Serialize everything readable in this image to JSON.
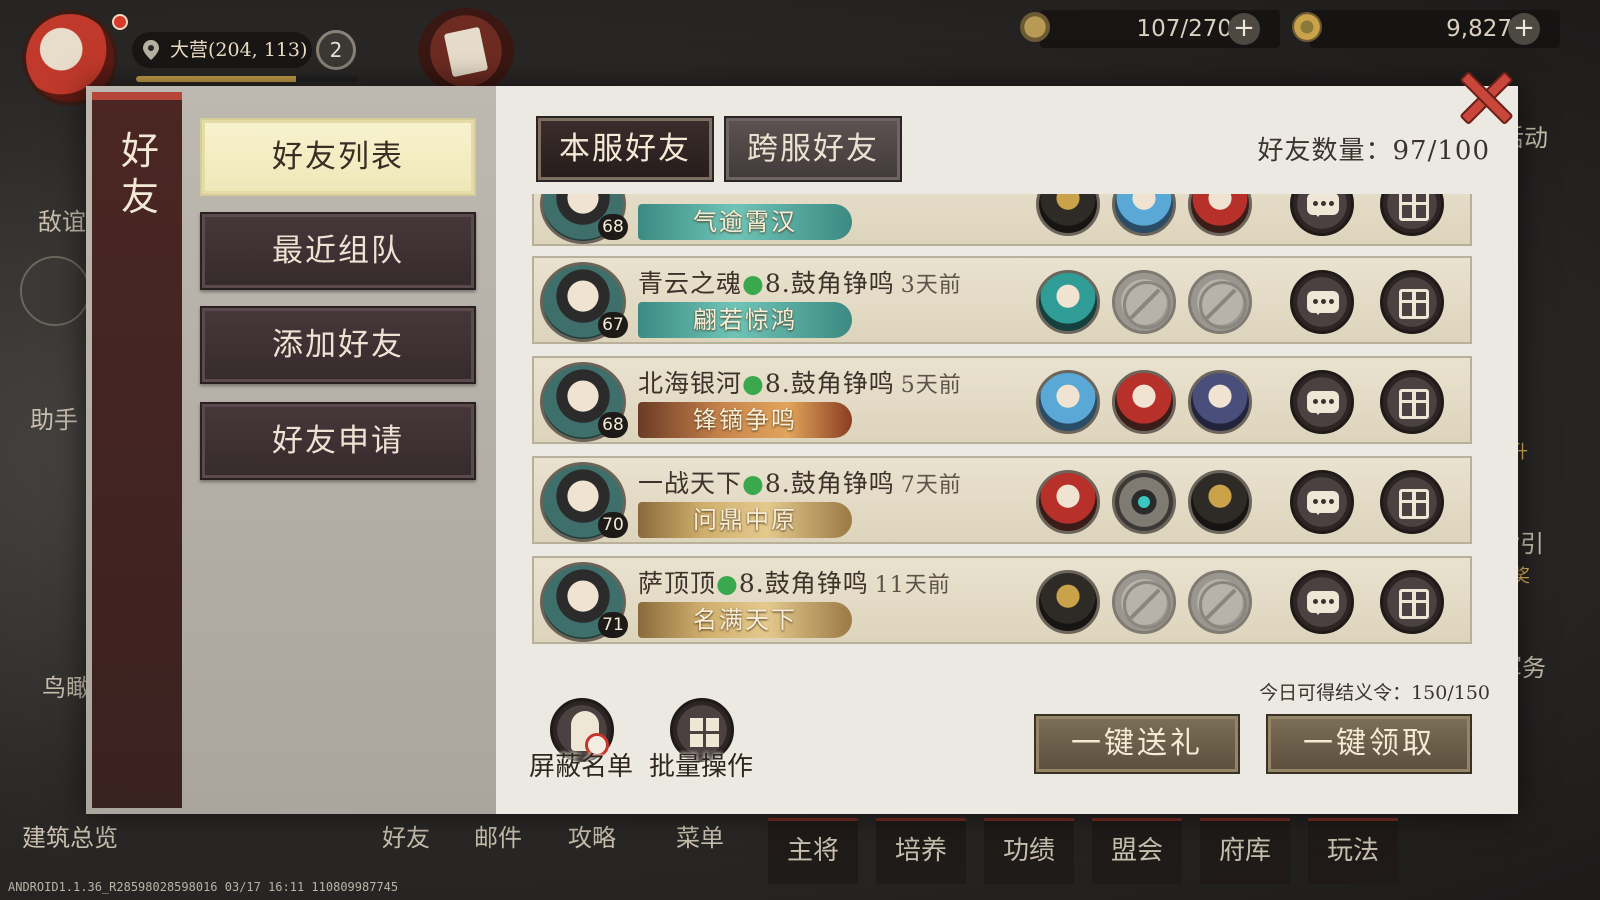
{
  "hud": {
    "location": "大营(204, 113)",
    "level_badge": "2",
    "xp_progress": 0.72,
    "food": "107/270",
    "coins": "9,827"
  },
  "background": {
    "left_labels": [
      "敌谊",
      "助手",
      "鸟瞰",
      "建筑总览"
    ],
    "right_labels": [
      "活动",
      "提升",
      "指引",
      "领奖",
      "军务"
    ],
    "bottom_nav": [
      "好友",
      "邮件",
      "攻略",
      "菜单"
    ],
    "bottom_tabs": [
      "主将",
      "培养",
      "功绩",
      "盟会",
      "府库",
      "玩法"
    ],
    "debug": "ANDROID1.1.36_R28598028598016 03/17 16:11 110809987745"
  },
  "modal": {
    "title": "好友",
    "menu": [
      {
        "label": "好友列表",
        "active": true
      },
      {
        "label": "最近组队",
        "active": false
      },
      {
        "label": "添加好友",
        "active": false
      },
      {
        "label": "好友申请",
        "active": false
      }
    ],
    "tabs": [
      {
        "label": "本服好友",
        "active": true
      },
      {
        "label": "跨服好友",
        "active": false
      }
    ],
    "friend_count": "好友数量：97/100",
    "friends": [
      {
        "name": "",
        "server": "",
        "ago": "",
        "level": "68",
        "title": "气逾霄汉",
        "title_style": "jade",
        "heroes": [
          "gold",
          "blue",
          "red"
        ],
        "partial": true
      },
      {
        "name": "青云之魂",
        "server": "8.鼓角铮鸣",
        "ago": "3天前",
        "level": "67",
        "title": "翩若惊鸿",
        "title_style": "jade",
        "heroes": [
          "teal",
          "empty",
          "empty"
        ]
      },
      {
        "name": "北海银河",
        "server": "8.鼓角铮鸣",
        "ago": "5天前",
        "level": "68",
        "title": "锋镝争鸣",
        "title_style": "flame",
        "heroes": [
          "blue",
          "red",
          "purple"
        ]
      },
      {
        "name": "一战天下",
        "server": "8.鼓角铮鸣",
        "ago": "7天前",
        "level": "70",
        "title": "问鼎中原",
        "title_style": "gold",
        "heroes": [
          "red",
          "compass",
          "gold"
        ]
      },
      {
        "name": "萨顶顶",
        "server": "8.鼓角铮鸣",
        "ago": "11天前",
        "level": "71",
        "title": "名满天下",
        "title_style": "gold",
        "heroes": [
          "gold",
          "empty",
          "empty"
        ]
      }
    ],
    "daily_token": "今日可得结义令：150/150",
    "block_list_label": "屏蔽名单",
    "batch_label": "批量操作",
    "send_all_label": "一键送礼",
    "claim_all_label": "一键领取"
  }
}
